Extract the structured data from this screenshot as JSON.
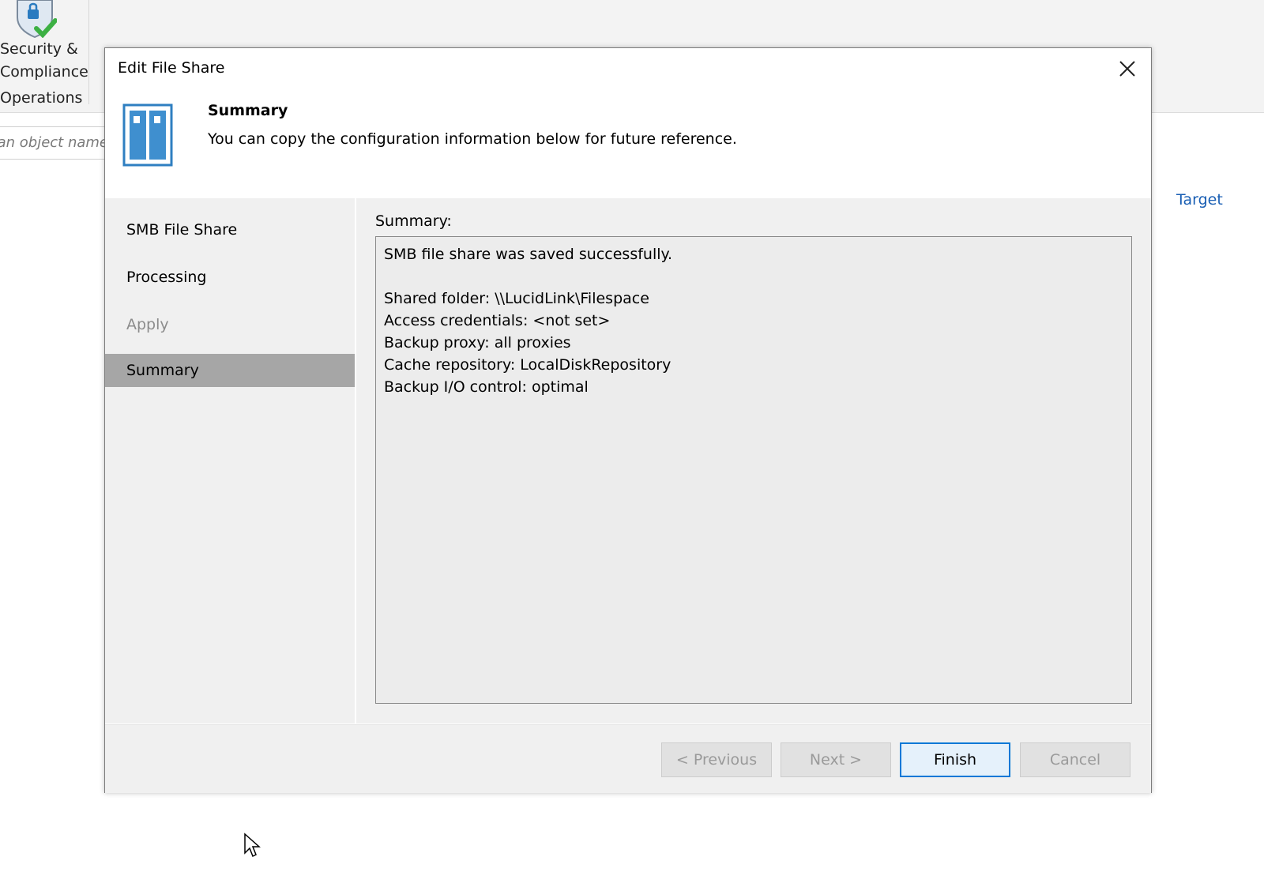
{
  "background": {
    "ribbon_item_label_line1": "Security &",
    "ribbon_item_label_line2": "Compliance",
    "ribbon_group_label": "Operations",
    "search_placeholder": "in an object name",
    "target_link": "Target"
  },
  "dialog": {
    "title": "Edit File Share",
    "header": {
      "title": "Summary",
      "description": "You can copy the configuration information below for future reference."
    },
    "steps": [
      {
        "label": "SMB File Share",
        "state": "normal"
      },
      {
        "label": "Processing",
        "state": "normal"
      },
      {
        "label": "Apply",
        "state": "disabled"
      },
      {
        "label": "Summary",
        "state": "active"
      }
    ],
    "summary_label": "Summary:",
    "summary_lines": [
      "SMB file share was saved successfully.",
      "",
      "Shared folder: \\\\LucidLink\\Filespace",
      "Access credentials: <not set>",
      "Backup proxy: all proxies",
      "Cache repository: LocalDiskRepository",
      "Backup I/O control: optimal"
    ],
    "buttons": {
      "previous": "< Previous",
      "next": "Next >",
      "finish": "Finish",
      "cancel": "Cancel"
    }
  },
  "colors": {
    "accent": "#0078d7",
    "active_step": "#a6a6a6",
    "link": "#1a5fb4",
    "shield_check": "#3cb043"
  }
}
